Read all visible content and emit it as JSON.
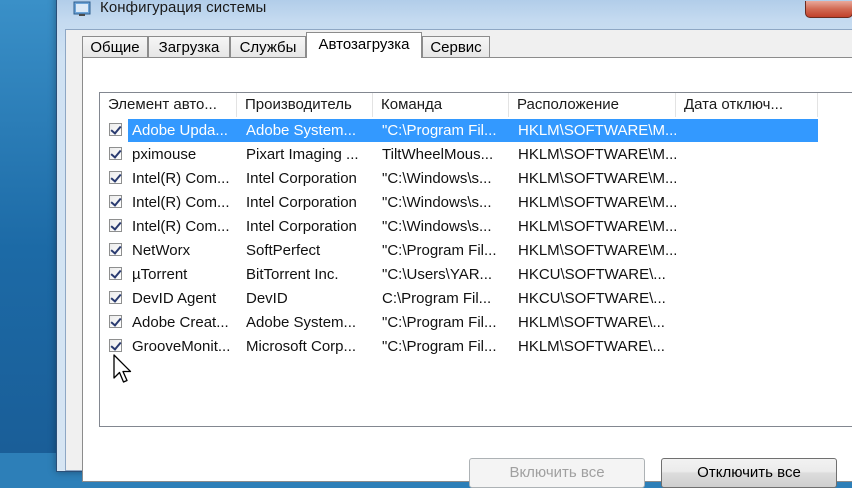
{
  "window": {
    "title": "Конфигурация системы"
  },
  "tabs": [
    {
      "label": "Общие"
    },
    {
      "label": "Загрузка"
    },
    {
      "label": "Службы"
    },
    {
      "label": "Автозагрузка",
      "active": true
    },
    {
      "label": "Сервис"
    }
  ],
  "columns": [
    "Элемент авто...",
    "Производитель",
    "Команда",
    "Расположение",
    "Дата отключ..."
  ],
  "rows": [
    {
      "checked": true,
      "selected": true,
      "item": "Adobe Upda...",
      "maker": "Adobe System...",
      "command": "\"C:\\Program Fil...",
      "location": "HKLM\\SOFTWARE\\M...",
      "date": ""
    },
    {
      "checked": true,
      "selected": false,
      "item": "pximouse",
      "maker": "Pixart Imaging ...",
      "command": "TiltWheelMous...",
      "location": "HKLM\\SOFTWARE\\M...",
      "date": ""
    },
    {
      "checked": true,
      "selected": false,
      "item": "Intel(R) Com...",
      "maker": "Intel Corporation",
      "command": "\"C:\\Windows\\s...",
      "location": "HKLM\\SOFTWARE\\M...",
      "date": ""
    },
    {
      "checked": true,
      "selected": false,
      "item": "Intel(R) Com...",
      "maker": "Intel Corporation",
      "command": "\"C:\\Windows\\s...",
      "location": "HKLM\\SOFTWARE\\M...",
      "date": ""
    },
    {
      "checked": true,
      "selected": false,
      "item": "Intel(R) Com...",
      "maker": "Intel Corporation",
      "command": "\"C:\\Windows\\s...",
      "location": "HKLM\\SOFTWARE\\M...",
      "date": ""
    },
    {
      "checked": true,
      "selected": false,
      "item": "NetWorx",
      "maker": "SoftPerfect",
      "command": "\"C:\\Program Fil...",
      "location": "HKLM\\SOFTWARE\\M...",
      "date": ""
    },
    {
      "checked": true,
      "selected": false,
      "item": "µTorrent",
      "maker": "BitTorrent Inc.",
      "command": "\"C:\\Users\\YAR...",
      "location": "HKCU\\SOFTWARE\\...",
      "date": ""
    },
    {
      "checked": true,
      "selected": false,
      "item": "DevID Agent",
      "maker": "DevID",
      "command": "C:\\Program Fil...",
      "location": "HKCU\\SOFTWARE\\...",
      "date": ""
    },
    {
      "checked": true,
      "selected": false,
      "item": "Adobe Creat...",
      "maker": "Adobe System...",
      "command": "\"C:\\Program Fil...",
      "location": "HKLM\\SOFTWARE\\...",
      "date": ""
    },
    {
      "checked": true,
      "selected": false,
      "item": "GrooveMonit...",
      "maker": "Microsoft Corp...",
      "command": "\"C:\\Program Fil...",
      "location": "HKLM\\SOFTWARE\\...",
      "date": ""
    }
  ],
  "buttons": {
    "enable_all": "Включить все",
    "disable_all": "Отключить все"
  },
  "colors": {
    "selection": "#3399ff",
    "frame": "#c4daf0"
  }
}
